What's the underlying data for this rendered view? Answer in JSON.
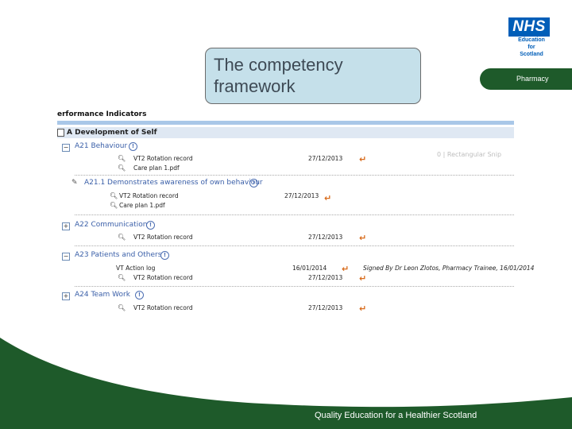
{
  "slide_title": {
    "line1": "The competency",
    "line2": "framework"
  },
  "logo": {
    "brand": "NHS",
    "line1": "Education",
    "line2": "for",
    "line3": "Scotland"
  },
  "dept_label": "Pharmacy",
  "shot": {
    "header": "erformance Indicators",
    "section": "A Development of Self",
    "watermark": "0 | Rectangular Snip",
    "rows": [
      {
        "label": "A21 Behaviour",
        "files": [
          {
            "name": "VT2 Rotation record",
            "date": "27/12/2013"
          },
          {
            "name": "Care plan 1.pdf",
            "date": ""
          }
        ]
      },
      {
        "label": "A21.1 Demonstrates awareness of own behaviour",
        "files": [
          {
            "name": "VT2 Rotation record",
            "date": "27/12/2013"
          },
          {
            "name": "Care plan 1.pdf",
            "date": ""
          }
        ]
      },
      {
        "label": "A22 Communication",
        "files": [
          {
            "name": "VT2 Rotation record",
            "date": "27/12/2013"
          }
        ]
      },
      {
        "label": "A23 Patients and Others",
        "files": [
          {
            "name": "VT Action log",
            "date": "16/01/2014",
            "signed": "Signed By Dr Leon Zlotos, Pharmacy Trainee, 16/01/2014"
          },
          {
            "name": "VT2 Rotation record",
            "date": "27/12/2013"
          }
        ]
      },
      {
        "label": "A24 Team Work",
        "files": [
          {
            "name": "VT2 Rotation record",
            "date": "27/12/2013"
          }
        ]
      }
    ]
  },
  "footer": "Quality Education for a Healthier Scotland",
  "colors": {
    "title_bg": "#c5e0ea",
    "nhs_blue": "#005eb8",
    "green": "#1e5a2a",
    "link_blue": "#3a5fa8"
  }
}
